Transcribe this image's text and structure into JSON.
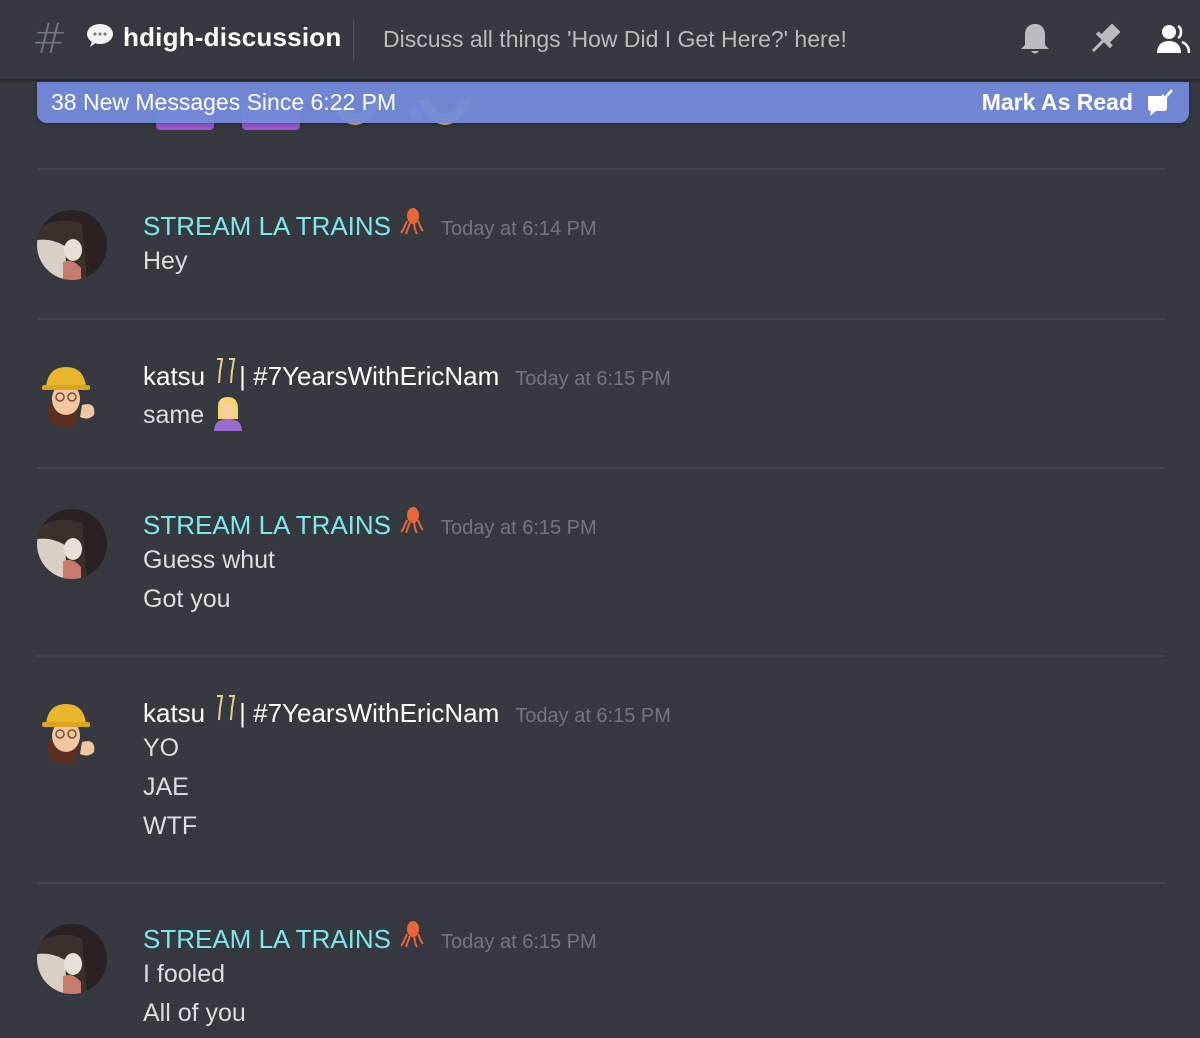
{
  "header": {
    "channel_name": "hdigh-discussion",
    "topic": "Discuss all things 'How Did I Get Here?' here!",
    "icons": [
      "hash-icon",
      "speech-bubble-icon",
      "bell-icon",
      "pin-icon",
      "members-icon"
    ]
  },
  "banner": {
    "text": "38 New Messages Since 6:22 PM",
    "mark_read_label": "Mark As Read"
  },
  "colors": {
    "background": "#36393f",
    "banner": "#7289da",
    "stream_username": "#7de7eb",
    "timestamp": "#72767d",
    "message_text": "#dcddde"
  },
  "messages": [
    {
      "author": "STREAM LA TRAINS",
      "author_emoji": "squid",
      "timestamp": "Today at 6:14 PM",
      "lines": [
        "Hey"
      ]
    },
    {
      "author": "katsu",
      "author_emoji": "champagne-glasses",
      "author_suffix": " | #7YearsWithEricNam",
      "timestamp": "Today at 6:15 PM",
      "lines": [
        "same"
      ],
      "line_emoji": "facepalm"
    },
    {
      "author": "STREAM LA TRAINS",
      "author_emoji": "squid",
      "timestamp": "Today at 6:15 PM",
      "lines": [
        "Guess whut",
        "Got you"
      ]
    },
    {
      "author": "katsu",
      "author_emoji": "champagne-glasses",
      "author_suffix": " | #7YearsWithEricNam",
      "timestamp": "Today at 6:15 PM",
      "lines": [
        "YO",
        "JAE",
        "WTF"
      ]
    },
    {
      "author": "STREAM LA TRAINS",
      "author_emoji": "squid",
      "timestamp": "Today at 6:15 PM",
      "lines": [
        "I fooled",
        "All of you"
      ]
    }
  ]
}
